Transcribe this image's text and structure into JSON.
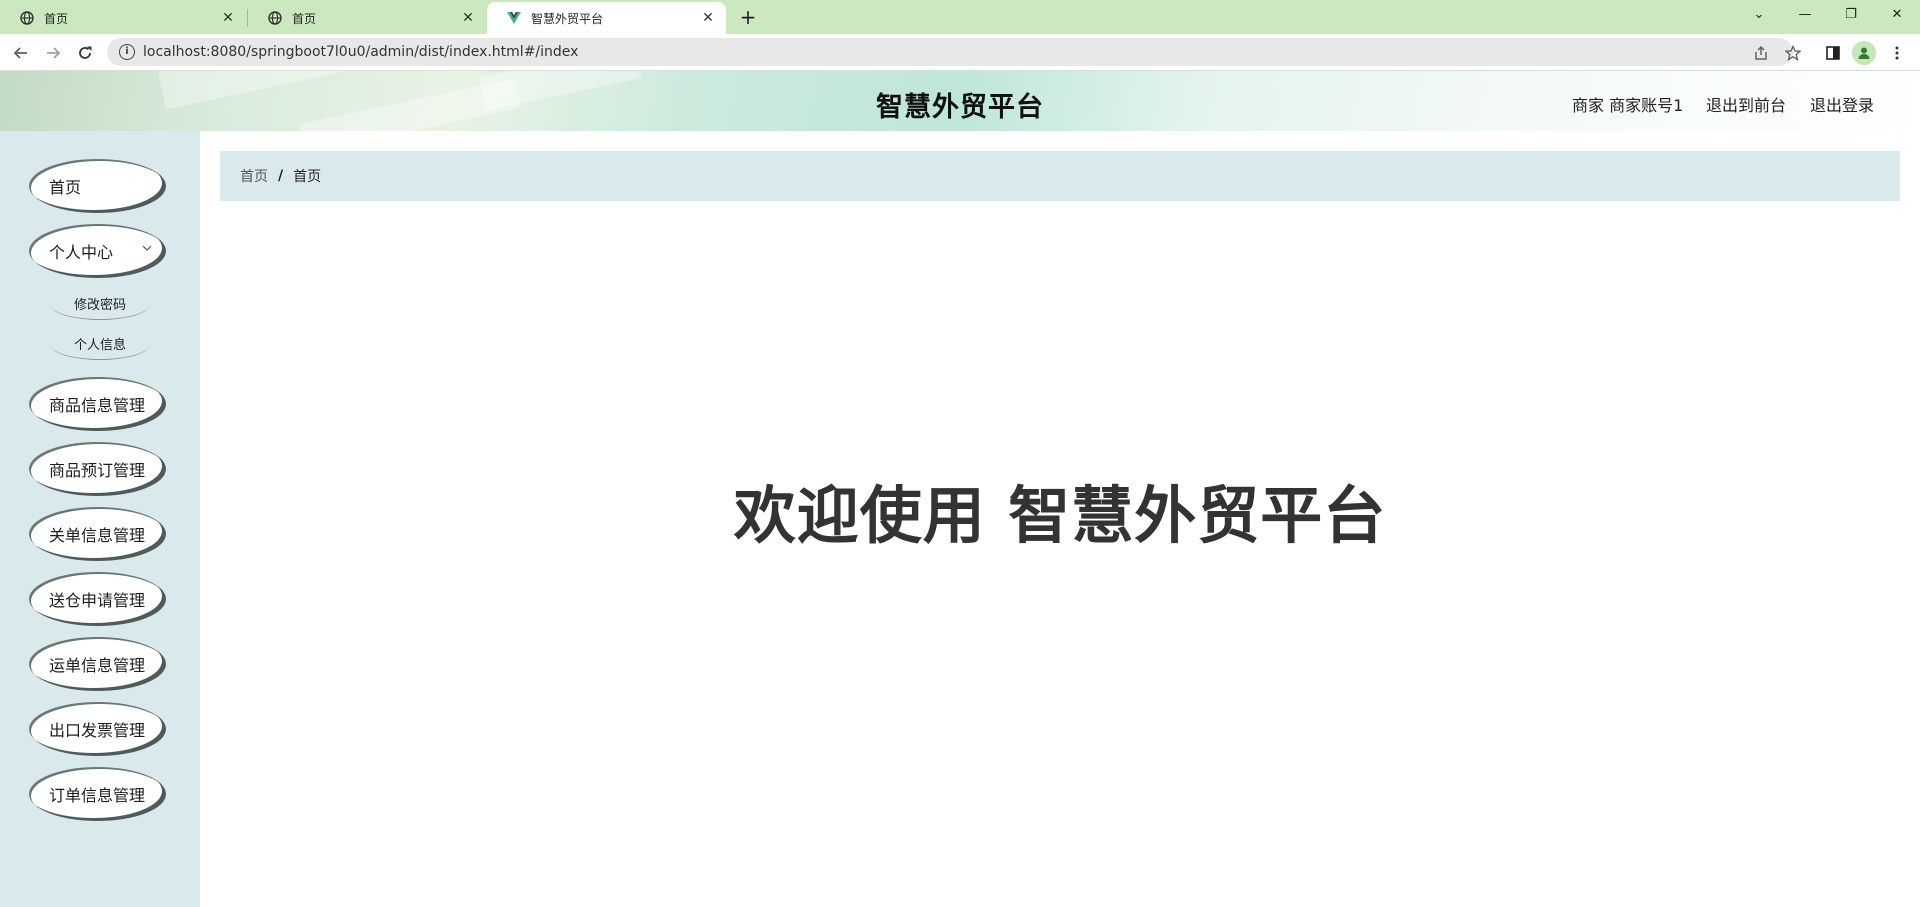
{
  "browser": {
    "tabs": [
      {
        "title": "首页",
        "icon": "globe-icon"
      },
      {
        "title": "首页",
        "icon": "globe-icon"
      },
      {
        "title": "智慧外贸平台",
        "icon": "vue-logo-icon"
      }
    ],
    "close_glyph": "✕",
    "new_tab_glyph": "+",
    "url": "localhost:8080/springboot7l0u0/admin/dist/index.html#/index",
    "window_controls": [
      "⌄",
      "—",
      "❐",
      "✕"
    ]
  },
  "header": {
    "title": "智慧外贸平台",
    "user_label": "商家 商家账号1",
    "to_frontend": "退出到前台",
    "logout": "退出登录"
  },
  "sidebar": {
    "items": [
      {
        "label": "首页"
      },
      {
        "label": "个人中心",
        "expanded": true
      },
      {
        "label": "商品信息管理"
      },
      {
        "label": "商品预订管理"
      },
      {
        "label": "关单信息管理"
      },
      {
        "label": "送仓申请管理"
      },
      {
        "label": "运单信息管理"
      },
      {
        "label": "出口发票管理"
      },
      {
        "label": "订单信息管理"
      }
    ],
    "sub_items": [
      {
        "label": "修改密码"
      },
      {
        "label": "个人信息"
      }
    ]
  },
  "breadcrumb": {
    "home": "首页",
    "separator": "/",
    "current": "首页"
  },
  "main": {
    "welcome": "欢迎使用 智慧外贸平台"
  },
  "colors": {
    "tab_strip": "#cce8c0",
    "sidebar_bg": "#d9e9ec",
    "breadcrumb_bg": "#d9e9ec",
    "welcome_text": "#333333"
  }
}
